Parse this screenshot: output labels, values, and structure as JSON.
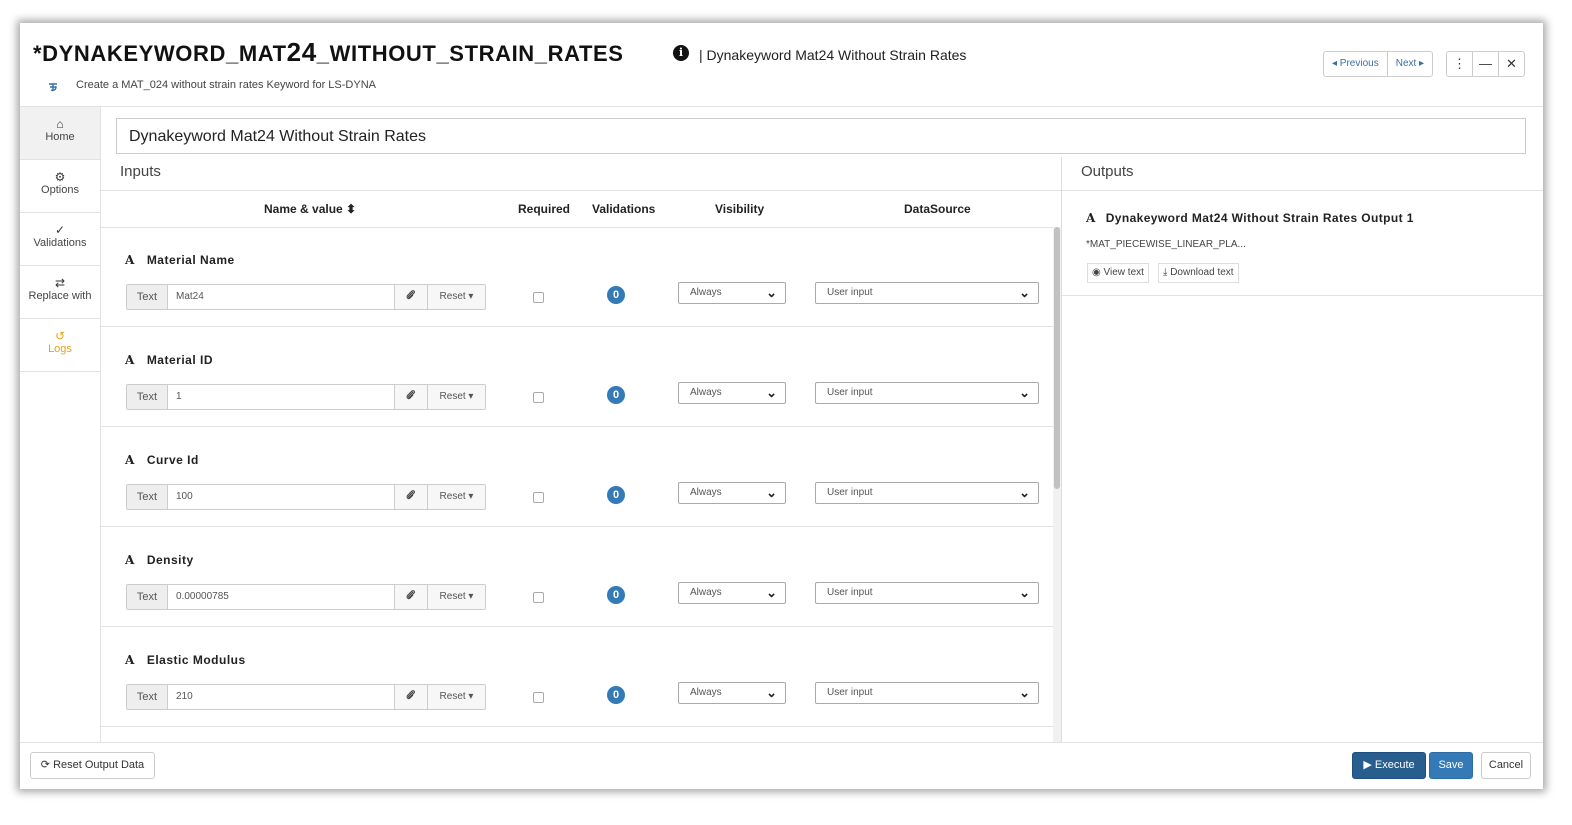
{
  "header": {
    "title_prefix": "*DYNAKEYWORD_MAT",
    "title_num": "24",
    "title_suffix": "_WITHOUT_STRAIN_RATES",
    "info_icon": "i",
    "subtitle": "| Dynakeyword Mat24 Without Strain Rates",
    "description": "Create a MAT_024 without strain rates Keyword for LS-DYNA",
    "prev_label": "◂ Previous",
    "next_label": "Next ▸",
    "more_glyph": "⋮",
    "minimize_glyph": "—",
    "close_glyph": "✕"
  },
  "sidebar": {
    "items": [
      {
        "icon": "⌂",
        "label": "Home"
      },
      {
        "icon": "⚙",
        "label": "Options"
      },
      {
        "icon": "✓",
        "label": "Validations"
      },
      {
        "icon": "⇄",
        "label": "Replace with"
      },
      {
        "icon": "↺",
        "label": "Logs"
      }
    ]
  },
  "workflow_name": "Dynakeyword Mat24 Without Strain Rates",
  "inputs": {
    "title": "Inputs",
    "columns": {
      "name_value": "Name & value ⬍",
      "required": "Required",
      "validations": "Validations",
      "visibility": "Visibility",
      "datasource": "DataSource"
    },
    "rows": [
      {
        "label": "Material Name",
        "type": "Text",
        "value": "Mat24",
        "reset": "Reset ▾",
        "validations": "0",
        "visibility": "Always",
        "datasource": "User input"
      },
      {
        "label": "Material ID",
        "type": "Text",
        "value": "1",
        "reset": "Reset ▾",
        "validations": "0",
        "visibility": "Always",
        "datasource": "User input"
      },
      {
        "label": "Curve Id",
        "type": "Text",
        "value": "100",
        "reset": "Reset ▾",
        "validations": "0",
        "visibility": "Always",
        "datasource": "User input"
      },
      {
        "label": "Density",
        "type": "Text",
        "value": "0.00000785",
        "reset": "Reset ▾",
        "validations": "0",
        "visibility": "Always",
        "datasource": "User input"
      },
      {
        "label": "Elastic Modulus",
        "type": "Text",
        "value": "210",
        "reset": "Reset ▾",
        "validations": "0",
        "visibility": "Always",
        "datasource": "User input"
      }
    ]
  },
  "outputs": {
    "title": "Outputs",
    "items": [
      {
        "label": "Dynakeyword Mat24 Without Strain Rates Output 1",
        "value": "*MAT_PIECEWISE_LINEAR_PLA...",
        "view_label": "View text",
        "download_label": "Download text"
      }
    ]
  },
  "footer": {
    "reset_output": "⟳ Reset Output Data",
    "execute": "▶ Execute",
    "save": "Save",
    "cancel": "Cancel"
  },
  "colors": {
    "primary": "#337ab7",
    "execute": "#285e8e",
    "logs": "#e8a317"
  }
}
